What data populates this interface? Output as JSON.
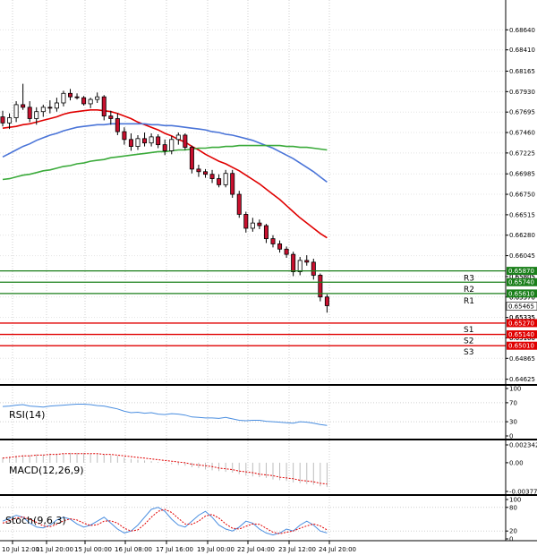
{
  "chart_data": [
    {
      "type": "candlestick",
      "title": "",
      "y_ticks": [
        0.6864,
        0.6841,
        0.68165,
        0.6793,
        0.67695,
        0.6746,
        0.67225,
        0.66985,
        0.6675,
        0.66515,
        0.6628,
        0.66045,
        0.65805,
        0.6557,
        0.65335,
        0.651,
        0.64865,
        0.64625
      ],
      "ylim": [
        0.6458,
        0.6888
      ],
      "x_ticks": [
        "10 Jul 12:00",
        "11 Jul 20:00",
        "15 Jul 00:00",
        "16 Jul 08:00",
        "17 Jul 16:00",
        "19 Jul 00:00",
        "22 Jul 04:00",
        "23 Jul 12:00",
        "24 Jul 20:00"
      ],
      "levels": [
        {
          "name": "R3",
          "value": 0.6587,
          "color": "#1a7f1a"
        },
        {
          "name": "R2",
          "value": 0.6574,
          "color": "#1a7f1a"
        },
        {
          "name": "R1",
          "value": 0.6561,
          "color": "#1a7f1a"
        },
        {
          "name": "S1",
          "value": 0.6527,
          "color": "#e00000"
        },
        {
          "name": "S2",
          "value": 0.6514,
          "color": "#e00000"
        },
        {
          "name": "S3",
          "value": 0.6501,
          "color": "#e00000"
        }
      ],
      "level_labels": [
        "0.65870",
        "0.65740",
        "0.65610",
        "0.65270",
        "0.65140",
        "0.65010"
      ],
      "hidden_labels": [
        "0.65805",
        "0.65570",
        "0.65335",
        "0.65100"
      ],
      "current_price": 0.65465,
      "current_price_label": "0.65465",
      "candles": [
        [
          0.6764,
          0.6771,
          0.6753,
          0.6757
        ],
        [
          0.6757,
          0.6768,
          0.675,
          0.6763
        ],
        [
          0.6763,
          0.6782,
          0.6758,
          0.6778
        ],
        [
          0.6778,
          0.6802,
          0.6772,
          0.6775
        ],
        [
          0.6775,
          0.6782,
          0.6758,
          0.6762
        ],
        [
          0.6762,
          0.6775,
          0.6755,
          0.677
        ],
        [
          0.677,
          0.6778,
          0.6764,
          0.6775
        ],
        [
          0.6775,
          0.6783,
          0.6768,
          0.6774
        ],
        [
          0.6774,
          0.6786,
          0.677,
          0.678
        ],
        [
          0.678,
          0.6794,
          0.6776,
          0.6791
        ],
        [
          0.6791,
          0.6796,
          0.6783,
          0.6787
        ],
        [
          0.6787,
          0.6791,
          0.6784,
          0.6786
        ],
        [
          0.6786,
          0.6788,
          0.6777,
          0.6779
        ],
        [
          0.6779,
          0.6786,
          0.6774,
          0.6784
        ],
        [
          0.6784,
          0.6792,
          0.678,
          0.6787
        ],
        [
          0.6787,
          0.6789,
          0.676,
          0.6765
        ],
        [
          0.6765,
          0.6771,
          0.6755,
          0.6762
        ],
        [
          0.6762,
          0.6768,
          0.6743,
          0.6747
        ],
        [
          0.6747,
          0.6752,
          0.6732,
          0.6738
        ],
        [
          0.6738,
          0.6745,
          0.6725,
          0.673
        ],
        [
          0.673,
          0.6743,
          0.6726,
          0.6739
        ],
        [
          0.6739,
          0.6746,
          0.673,
          0.6734
        ],
        [
          0.6734,
          0.6745,
          0.673,
          0.6741
        ],
        [
          0.6741,
          0.6744,
          0.6728,
          0.6732
        ],
        [
          0.6732,
          0.6738,
          0.672,
          0.6725
        ],
        [
          0.6725,
          0.6742,
          0.6721,
          0.6738
        ],
        [
          0.6738,
          0.6746,
          0.6732,
          0.6743
        ],
        [
          0.6743,
          0.6745,
          0.6726,
          0.6729
        ],
        [
          0.6729,
          0.6731,
          0.6699,
          0.6704
        ],
        [
          0.6704,
          0.6709,
          0.6695,
          0.6701
        ],
        [
          0.6701,
          0.6704,
          0.6694,
          0.6698
        ],
        [
          0.6698,
          0.6703,
          0.6688,
          0.6693
        ],
        [
          0.6693,
          0.6698,
          0.6683,
          0.6686
        ],
        [
          0.6686,
          0.6703,
          0.6683,
          0.6699
        ],
        [
          0.6699,
          0.6703,
          0.6671,
          0.6675
        ],
        [
          0.6675,
          0.6679,
          0.6648,
          0.6652
        ],
        [
          0.6652,
          0.6655,
          0.6631,
          0.6636
        ],
        [
          0.6636,
          0.6648,
          0.6632,
          0.6642
        ],
        [
          0.6642,
          0.6646,
          0.6635,
          0.6639
        ],
        [
          0.6639,
          0.6641,
          0.6619,
          0.6624
        ],
        [
          0.6624,
          0.6628,
          0.6614,
          0.6618
        ],
        [
          0.6618,
          0.6622,
          0.6608,
          0.6612
        ],
        [
          0.6612,
          0.6615,
          0.6602,
          0.6606
        ],
        [
          0.6606,
          0.6609,
          0.6581,
          0.6586
        ],
        [
          0.6586,
          0.6603,
          0.6582,
          0.6599
        ],
        [
          0.6599,
          0.6605,
          0.6593,
          0.6597
        ],
        [
          0.6597,
          0.6601,
          0.6577,
          0.6582
        ],
        [
          0.6582,
          0.6584,
          0.6552,
          0.6557
        ],
        [
          0.6557,
          0.656,
          0.6539,
          0.6547
        ]
      ],
      "moving_averages": [
        {
          "color": "#e00000",
          "values": [
            0.6751,
            0.6752,
            0.6753,
            0.6755,
            0.6756,
            0.6758,
            0.676,
            0.6762,
            0.6764,
            0.6767,
            0.6769,
            0.677,
            0.6771,
            0.6772,
            0.6772,
            0.6771,
            0.677,
            0.6768,
            0.6765,
            0.6762,
            0.6758,
            0.6755,
            0.6752,
            0.6749,
            0.6745,
            0.6742,
            0.6738,
            0.6735,
            0.673,
            0.6726,
            0.6721,
            0.6717,
            0.6713,
            0.671,
            0.6706,
            0.6702,
            0.6697,
            0.6692,
            0.6687,
            0.6681,
            0.6675,
            0.6669,
            0.6662,
            0.6655,
            0.6648,
            0.6642,
            0.6636,
            0.663,
            0.6625
          ]
        },
        {
          "color": "#4a74d8",
          "values": [
            0.6718,
            0.6722,
            0.6726,
            0.673,
            0.6733,
            0.6737,
            0.674,
            0.6743,
            0.6745,
            0.6748,
            0.675,
            0.6752,
            0.6753,
            0.6754,
            0.6755,
            0.6755,
            0.6756,
            0.6756,
            0.6756,
            0.6756,
            0.6756,
            0.6756,
            0.6755,
            0.6755,
            0.6754,
            0.6754,
            0.6753,
            0.6752,
            0.6751,
            0.675,
            0.6749,
            0.6747,
            0.6746,
            0.6744,
            0.6743,
            0.6741,
            0.6739,
            0.6737,
            0.6734,
            0.6731,
            0.6728,
            0.6724,
            0.672,
            0.6716,
            0.6711,
            0.6706,
            0.6701,
            0.6695,
            0.6689
          ]
        },
        {
          "color": "#3aaa3a",
          "values": [
            0.6692,
            0.6693,
            0.6695,
            0.6697,
            0.6698,
            0.67,
            0.6702,
            0.6703,
            0.6705,
            0.6707,
            0.6708,
            0.671,
            0.6711,
            0.6713,
            0.6714,
            0.6715,
            0.6717,
            0.6718,
            0.6719,
            0.672,
            0.6721,
            0.6722,
            0.6723,
            0.6724,
            0.6724,
            0.6725,
            0.6726,
            0.6726,
            0.6727,
            0.6728,
            0.6728,
            0.6729,
            0.6729,
            0.673,
            0.673,
            0.6731,
            0.6731,
            0.6731,
            0.6731,
            0.6731,
            0.6731,
            0.6731,
            0.673,
            0.673,
            0.6729,
            0.6729,
            0.6728,
            0.6727,
            0.6726
          ]
        }
      ]
    },
    {
      "type": "line",
      "label": "RSI(14)",
      "y_ticks": [
        "100",
        "70",
        "30",
        "0"
      ],
      "ylim": [
        0,
        100
      ],
      "series": [
        {
          "values": [
            62,
            63,
            65,
            66,
            63,
            62,
            61,
            63,
            64,
            65,
            66,
            67,
            67,
            66,
            64,
            63,
            60,
            57,
            52,
            49,
            50,
            48,
            49,
            46,
            45,
            47,
            46,
            44,
            40,
            39,
            38,
            38,
            37,
            39,
            36,
            33,
            32,
            33,
            33,
            31,
            30,
            29,
            28,
            27,
            30,
            29,
            27,
            24,
            22
          ],
          "color": "#4a8ee0"
        }
      ]
    },
    {
      "type": "bar",
      "label": "MACD(12,26,9)",
      "y_ticks": [
        "0.002342",
        "0.00",
        "-0.003776"
      ],
      "ylim": [
        -0.003776,
        0.002342
      ],
      "series": [
        {
          "name": "histogram",
          "values": [
            0.0007,
            0.0008,
            0.0009,
            0.001,
            0.001,
            0.0011,
            0.0011,
            0.0012,
            0.0012,
            0.0012,
            0.0013,
            0.0013,
            0.0013,
            0.0012,
            0.0012,
            0.0011,
            0.001,
            0.0009,
            0.0007,
            0.0005,
            0.0004,
            0.0003,
            0.0002,
            0.0001,
            -0.0001,
            -0.0002,
            -0.0003,
            -0.0004,
            -0.0006,
            -0.0007,
            -0.0009,
            -0.001,
            -0.0011,
            -0.0012,
            -0.0013,
            -0.0015,
            -0.0017,
            -0.0018,
            -0.0019,
            -0.002,
            -0.0022,
            -0.0023,
            -0.0024,
            -0.0026,
            -0.0027,
            -0.0028,
            -0.0029,
            -0.0031,
            -0.0032
          ],
          "color": "#bdbdbd"
        },
        {
          "name": "signal",
          "values": [
            0.0006,
            0.0007,
            0.0008,
            0.0009,
            0.0009,
            0.001,
            0.001,
            0.0011,
            0.0011,
            0.0012,
            0.0012,
            0.0012,
            0.0012,
            0.0012,
            0.0012,
            0.0011,
            0.0011,
            0.001,
            0.0009,
            0.0008,
            0.0007,
            0.0006,
            0.0005,
            0.0004,
            0.0003,
            0.0002,
            0.0001,
            0,
            -0.0002,
            -0.0003,
            -0.0004,
            -0.0005,
            -0.0007,
            -0.0008,
            -0.0009,
            -0.0011,
            -0.0012,
            -0.0013,
            -0.0015,
            -0.0016,
            -0.0017,
            -0.0019,
            -0.002,
            -0.0021,
            -0.0023,
            -0.0024,
            -0.0025,
            -0.0027,
            -0.0028
          ],
          "color": "#e00000"
        }
      ]
    },
    {
      "type": "line",
      "label": "Stoch(9,6,3)",
      "y_ticks": [
        "100",
        "80",
        "20",
        "0"
      ],
      "ylim": [
        0,
        100
      ],
      "series": [
        {
          "name": "main",
          "values": [
            45,
            52,
            60,
            55,
            40,
            30,
            28,
            35,
            48,
            55,
            50,
            38,
            30,
            35,
            45,
            55,
            40,
            25,
            15,
            20,
            35,
            55,
            75,
            80,
            70,
            50,
            35,
            30,
            45,
            60,
            70,
            55,
            35,
            25,
            20,
            30,
            45,
            40,
            25,
            15,
            10,
            15,
            25,
            20,
            35,
            45,
            35,
            20,
            15
          ],
          "color": "#4a8ee0"
        },
        {
          "name": "signal",
          "values": [
            40,
            46,
            53,
            56,
            50,
            42,
            33,
            31,
            37,
            46,
            51,
            48,
            40,
            34,
            36,
            45,
            46,
            40,
            27,
            20,
            23,
            37,
            55,
            70,
            75,
            67,
            52,
            38,
            37,
            45,
            58,
            62,
            53,
            38,
            27,
            25,
            32,
            38,
            37,
            27,
            17,
            13,
            17,
            20,
            27,
            33,
            38,
            33,
            23
          ],
          "color": "#e00000"
        }
      ]
    }
  ]
}
